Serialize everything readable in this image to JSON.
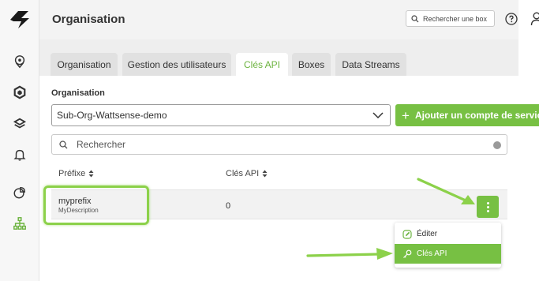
{
  "app": {
    "brand_icon": "lightning-logo-icon",
    "accent_color": "#77c043"
  },
  "sidebar": {
    "items": [
      {
        "name": "location-icon"
      },
      {
        "name": "cube-outline-icon"
      },
      {
        "name": "layers-icon"
      },
      {
        "name": "bell-icon"
      },
      {
        "name": "chart-pie-icon"
      },
      {
        "name": "org-tree-icon",
        "active": true
      }
    ]
  },
  "header": {
    "title": "Organisation",
    "search_placeholder": "Rechercher une box",
    "help_icon": "help-circle-icon",
    "user_icon": "user-icon"
  },
  "tabs": [
    {
      "label": "Organisation",
      "active": false
    },
    {
      "label": "Gestion des utilisateurs",
      "active": false
    },
    {
      "label": "Clés API",
      "active": true
    },
    {
      "label": "Boxes",
      "active": false
    },
    {
      "label": "Data Streams",
      "active": false
    }
  ],
  "main": {
    "org_label": "Organisation",
    "org_selected": "Sub-Org-Wattsense-demo",
    "add_button_label": "Ajouter un compte de service",
    "filter_placeholder": "Rechercher",
    "table": {
      "columns": [
        "Préfixe",
        "Clés API"
      ],
      "rows": [
        {
          "prefix": "myprefix",
          "description": "MyDescription",
          "keys": "0"
        }
      ]
    }
  },
  "context_menu": {
    "items": [
      {
        "label": "Éditer",
        "icon": "edit-icon",
        "active": false
      },
      {
        "label": "Clés API",
        "icon": "key-icon",
        "active": true
      }
    ]
  }
}
